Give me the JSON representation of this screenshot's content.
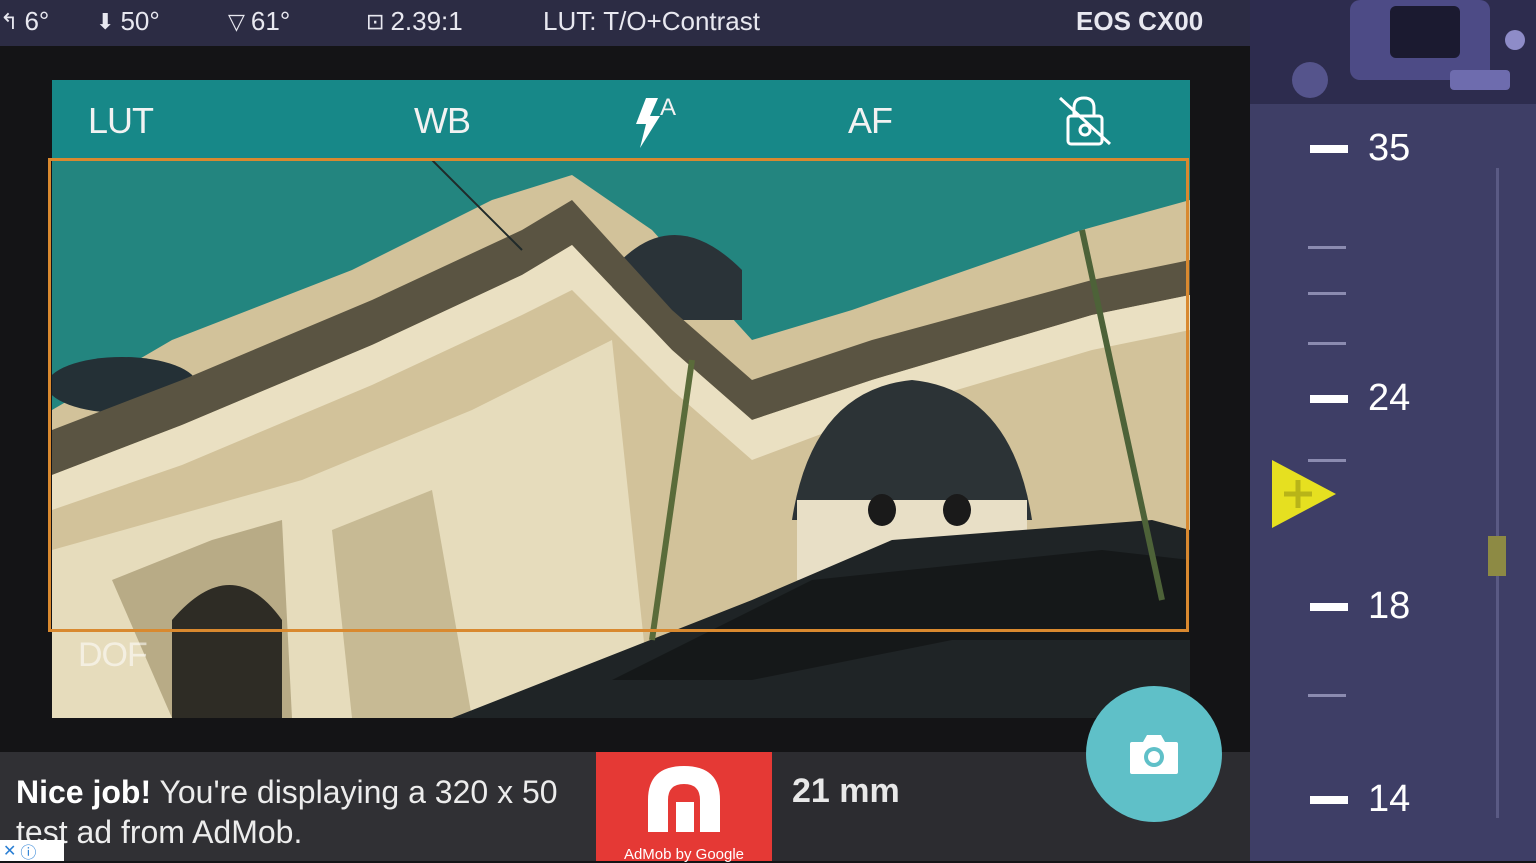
{
  "status_bar": {
    "roll": "6°",
    "pitch": "50°",
    "fov": "61°",
    "aspect_ratio": "2.39:1",
    "lut": "LUT: T/O+Contrast",
    "camera_model": "EOS CX00"
  },
  "toolbar": {
    "lut": "LUT",
    "wb": "WB",
    "flash_mode": "A",
    "af": "AF"
  },
  "overlay": {
    "dof": "DOF"
  },
  "focal_scale": {
    "labels": [
      "35",
      "24",
      "18",
      "14"
    ],
    "selected_mm": 21
  },
  "bottom": {
    "ad_title": "Nice job!",
    "ad_text": "You're displaying a 320 x 50 test ad from AdMob.",
    "ad_logo_caption": "AdMob by Google",
    "focal_readout": "21 mm"
  },
  "colors": {
    "accent": "#5fc0c8",
    "frame": "#d9892f",
    "pointer": "#e6e020",
    "panel": "#3e3e66"
  }
}
